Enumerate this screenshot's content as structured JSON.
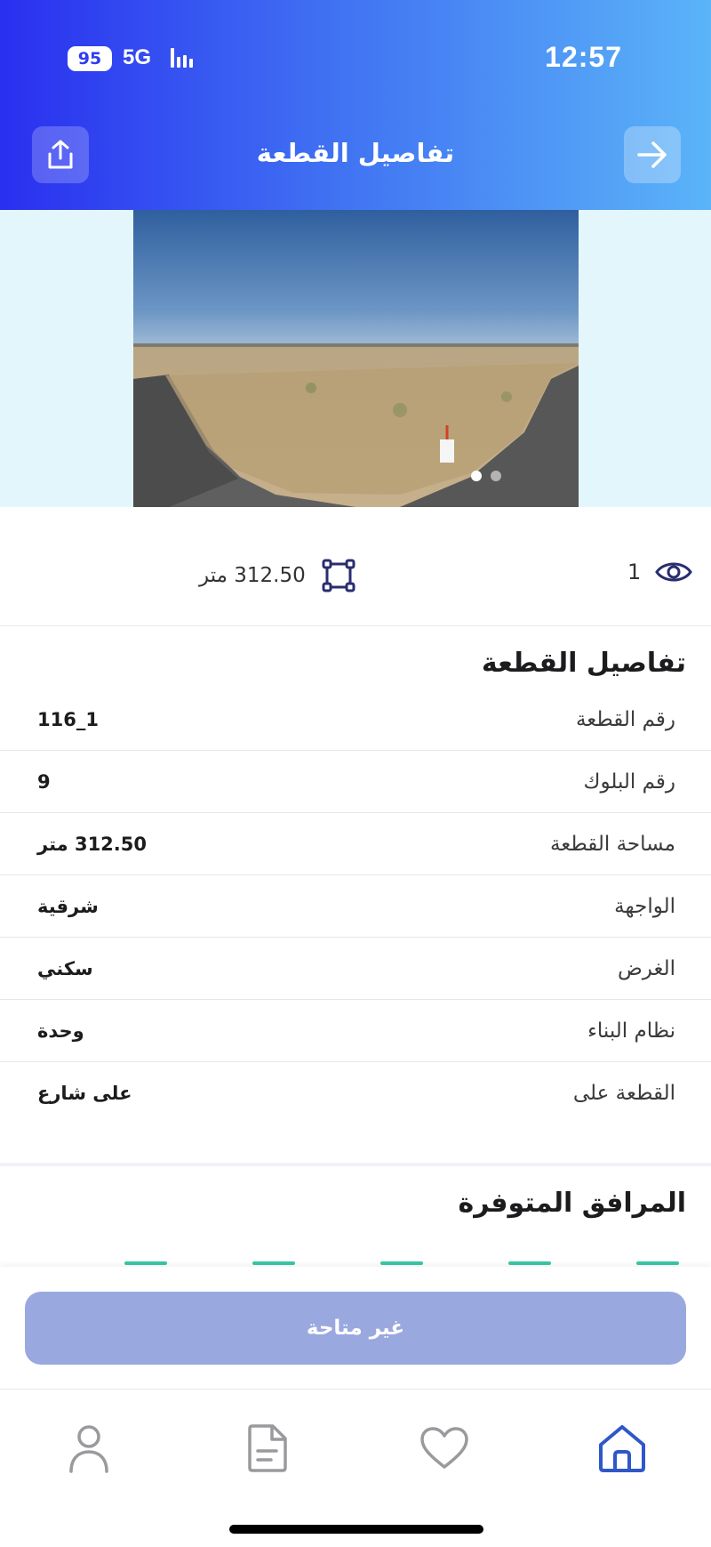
{
  "status_bar": {
    "battery": "95",
    "network": "5G",
    "time": "12:57"
  },
  "header": {
    "title": "تفاصيل القطعة",
    "share_icon": "share-icon",
    "back_icon": "arrow-right-icon"
  },
  "gallery": {
    "image_count": 2,
    "active_index": 0
  },
  "stats": {
    "views": "1",
    "area": "312.50 متر"
  },
  "details": {
    "title": "تفاصيل القطعة",
    "rows": [
      {
        "label": "رقم القطعة",
        "value": "116_1"
      },
      {
        "label": "رقم البلوك",
        "value": "9"
      },
      {
        "label": "مساحة القطعة",
        "value": "312.50 متر"
      },
      {
        "label": "الواجهة",
        "value": "شرقية"
      },
      {
        "label": "الغرض",
        "value": "سكني"
      },
      {
        "label": "نظام البناء",
        "value": "وحدة"
      },
      {
        "label": "القطعة على",
        "value": "على شارع"
      }
    ]
  },
  "amenities": {
    "title": "المرافق المتوفرة"
  },
  "cta": {
    "label": "غير متاحة"
  },
  "tabbar": {
    "items": [
      "profile-icon",
      "document-icon",
      "heart-icon",
      "home-icon"
    ],
    "active": "home-icon"
  },
  "colors": {
    "accent": "#2a2ff0",
    "cta_disabled": "#9aa8e0",
    "tab_active": "#2f57c9",
    "tab_inactive": "#9a9a9e"
  }
}
